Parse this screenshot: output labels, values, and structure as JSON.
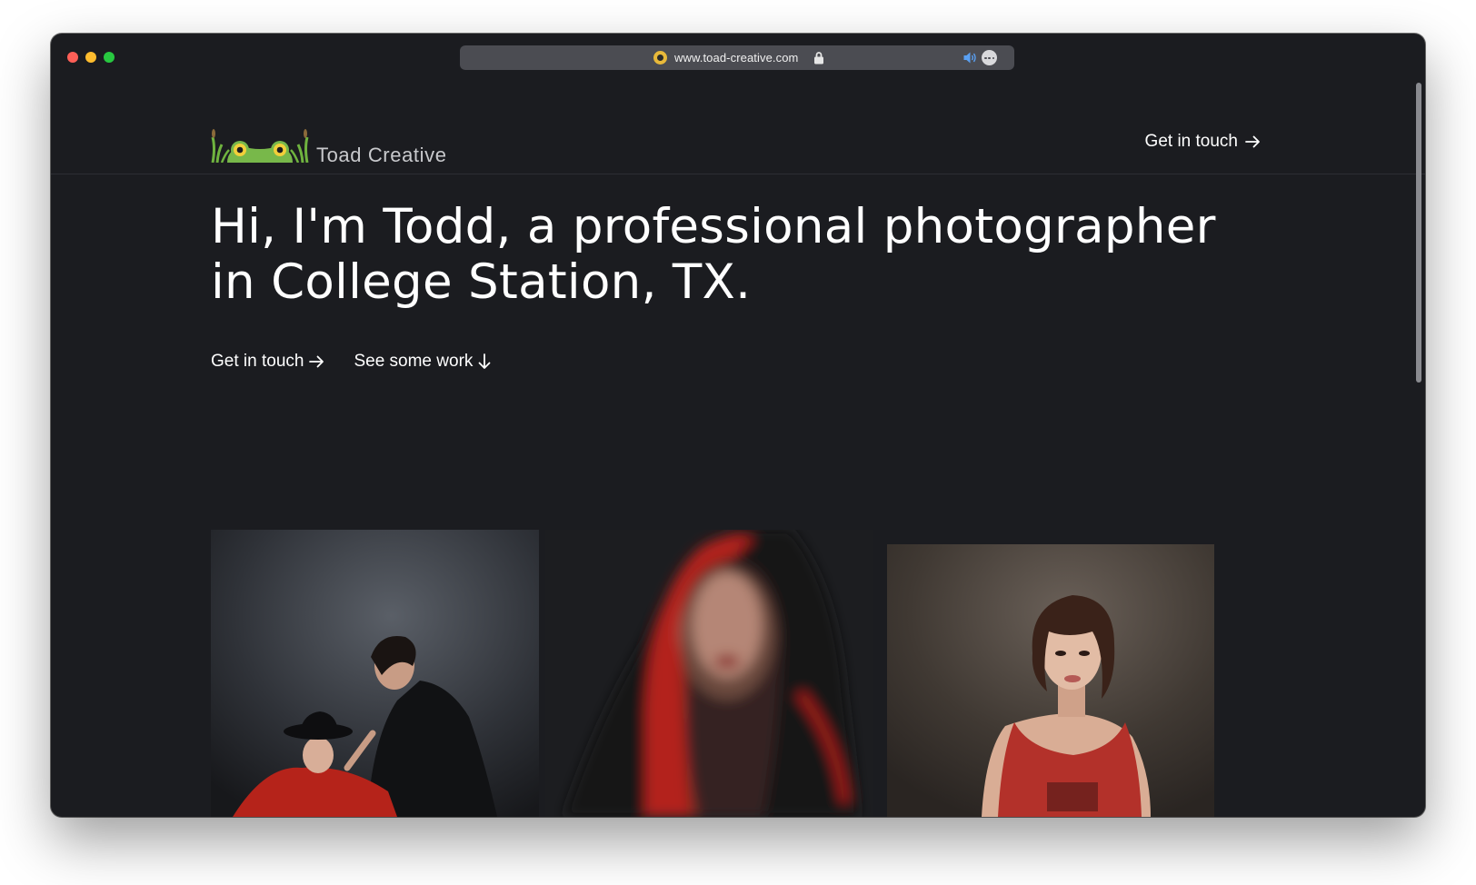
{
  "browser": {
    "url": "www.toad-creative.com",
    "traffic_colors": [
      "#fe5f57",
      "#febc2e",
      "#28c840"
    ]
  },
  "header": {
    "logo_text": "Toad Creative",
    "cta_label": "Get in touch"
  },
  "hero": {
    "title_line1": "Hi, I'm Todd, a professional photographer",
    "title_line2": "in College Station, TX.",
    "link_contact": "Get in touch",
    "link_work": "See some work"
  },
  "gallery": {
    "photos": [
      "couple-portrait",
      "red-hood-portrait",
      "red-tank-top-portrait"
    ]
  },
  "colors": {
    "page_bg": "#1b1c20",
    "text": "#ffffff",
    "logo_green": "#6fb33f",
    "accent_red": "#c42a1e"
  }
}
